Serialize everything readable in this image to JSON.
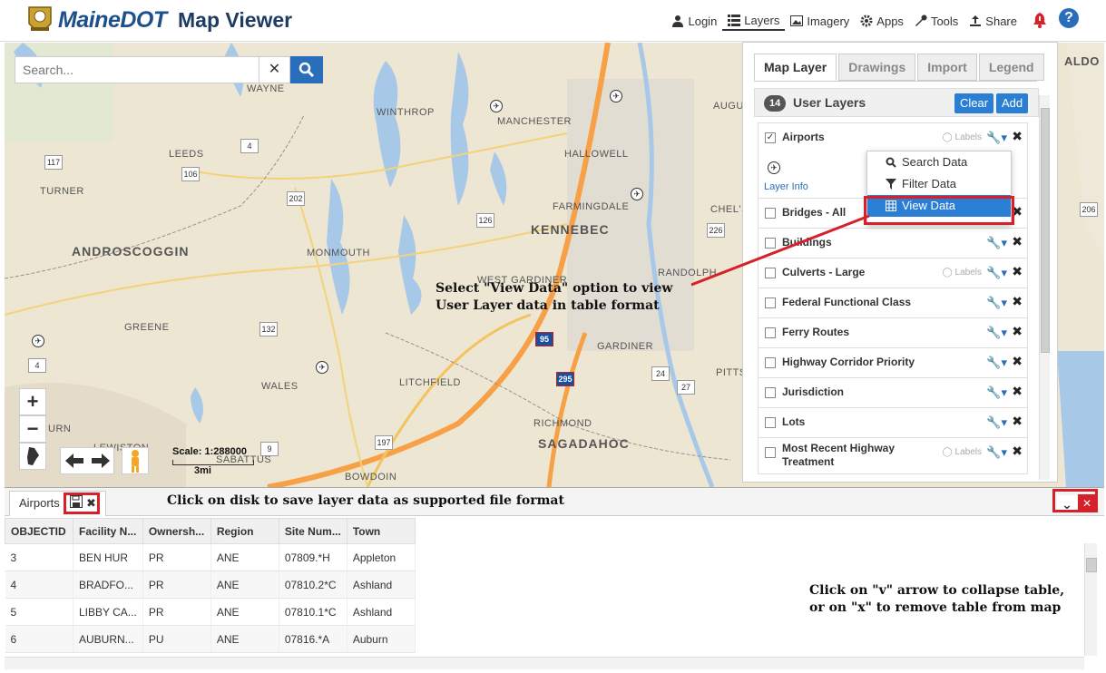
{
  "header": {
    "brand": "MaineDOT",
    "title": "Map Viewer",
    "nav": [
      {
        "label": "Login",
        "icon": "user-icon"
      },
      {
        "label": "Layers",
        "icon": "list-icon"
      },
      {
        "label": "Imagery",
        "icon": "image-icon"
      },
      {
        "label": "Apps",
        "icon": "gear-icon"
      },
      {
        "label": "Tools",
        "icon": "wrench-icon"
      },
      {
        "label": "Share",
        "icon": "share-icon"
      }
    ],
    "help": "?"
  },
  "search": {
    "placeholder": "Search..."
  },
  "map": {
    "labels": [
      {
        "text": "WAYNE"
      },
      {
        "text": "WINTHROP"
      },
      {
        "text": "MANCHESTER"
      },
      {
        "text": "HALLOWELL"
      },
      {
        "text": "LEEDS"
      },
      {
        "text": "TURNER"
      },
      {
        "text": "FARMINGDALE"
      },
      {
        "text": "MONMOUTH"
      },
      {
        "text": "WEST GARDINER"
      },
      {
        "text": "RANDOLPH"
      },
      {
        "text": "GREENE"
      },
      {
        "text": "GARDINER"
      },
      {
        "text": "WALES"
      },
      {
        "text": "LITCHFIELD"
      },
      {
        "text": "RICHMOND"
      },
      {
        "text": "SABATTUS"
      },
      {
        "text": "BOWDOIN"
      },
      {
        "text": "LEWISTON"
      },
      {
        "text": "PITTS"
      },
      {
        "text": "CHEL'S"
      },
      {
        "text": "AUGU"
      },
      {
        "text": "ALDO"
      },
      {
        "text": "URN"
      }
    ],
    "counties": [
      {
        "text": "ANDROSCOGGIN"
      },
      {
        "text": "KENNEBEC"
      },
      {
        "text": "SAGADAHOC"
      }
    ],
    "shields": [
      "117",
      "106",
      "4",
      "202",
      "126",
      "132",
      "4",
      "9",
      "226",
      "24",
      "27",
      "197",
      "206"
    ],
    "interstates": [
      "95",
      "295"
    ],
    "scale_label": "Scale: 1:288000",
    "scale_bar": "3mi"
  },
  "panel": {
    "tabs": [
      "Map Layer",
      "Drawings",
      "Import",
      "Legend"
    ],
    "user_layers": {
      "count": "14",
      "title": "User Layers",
      "clear": "Clear",
      "add": "Add"
    },
    "layers": [
      {
        "name": "Airports",
        "checked": true,
        "labels": "Labels",
        "info": "Layer Info"
      },
      {
        "name": "Bridges - All",
        "checked": false
      },
      {
        "name": "Buildings",
        "checked": false
      },
      {
        "name": "Culverts - Large",
        "checked": false,
        "labels": "Labels"
      },
      {
        "name": "Federal Functional Class",
        "checked": false
      },
      {
        "name": "Ferry Routes",
        "checked": false
      },
      {
        "name": "Highway Corridor Priority",
        "checked": false
      },
      {
        "name": "Jurisdiction",
        "checked": false
      },
      {
        "name": "Lots",
        "checked": false
      },
      {
        "name": "Most Recent Highway Treatment",
        "checked": false,
        "labels": "Labels"
      }
    ],
    "dropdown": [
      "Search Data",
      "Filter Data",
      "View Data"
    ]
  },
  "annotations": {
    "view_data": "Select \"View Data\" option to view\nUser Layer data in table format",
    "save": "Click on disk to save layer data as supported file format",
    "collapse_line1": "Click on \"v\" arrow to collapse table,",
    "collapse_line2": "or on \"x\" to remove table from map"
  },
  "table": {
    "tab": "Airports",
    "columns": [
      "OBJECTID",
      "Facility N...",
      "Ownersh...",
      "Region",
      "Site Num...",
      "Town"
    ],
    "rows": [
      [
        "3",
        "BEN HUR",
        "PR",
        "ANE",
        "07809.*H",
        "Appleton"
      ],
      [
        "4",
        "BRADFO...",
        "PR",
        "ANE",
        "07810.2*C",
        "Ashland"
      ],
      [
        "5",
        "LIBBY CA...",
        "PR",
        "ANE",
        "07810.1*C",
        "Ashland"
      ],
      [
        "6",
        "AUBURN...",
        "PU",
        "ANE",
        "07816.*A",
        "Auburn"
      ]
    ]
  },
  "colors": {
    "accent": "#2a7fd4",
    "brand": "#1d4f8c",
    "annotation": "#d6202a"
  }
}
